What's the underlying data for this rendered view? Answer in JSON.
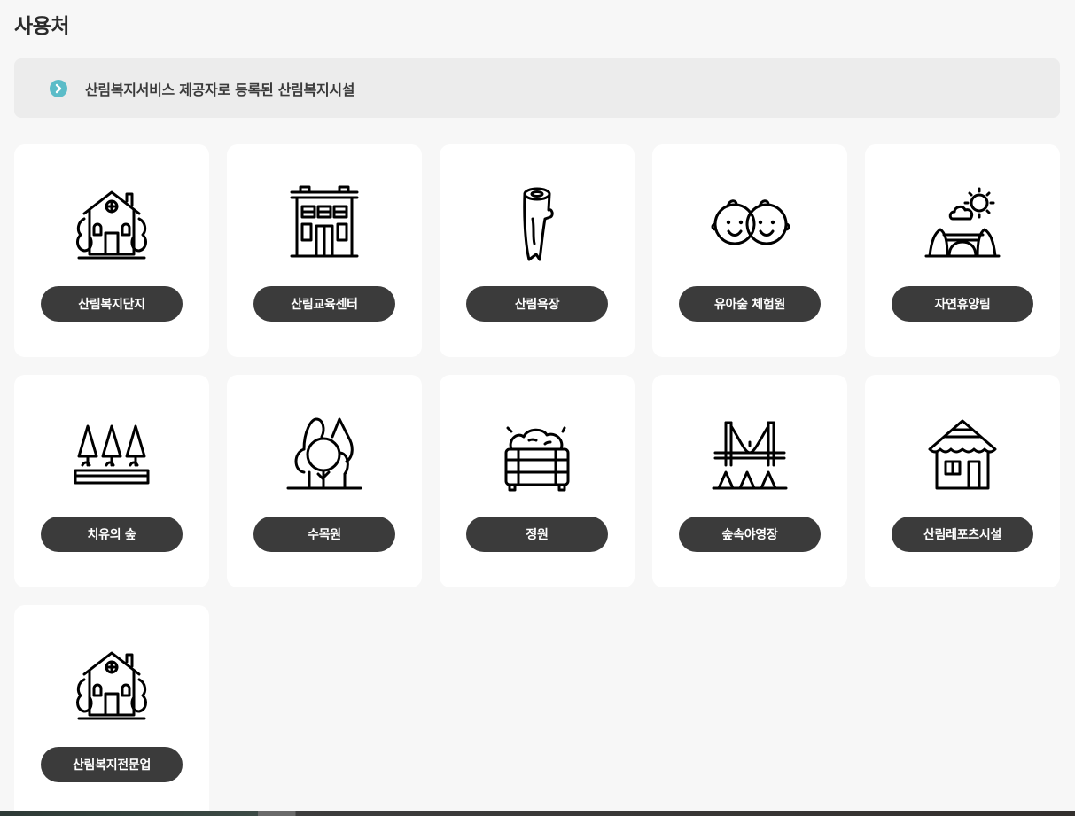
{
  "page": {
    "title": "사용처"
  },
  "notice": {
    "text": "산림복지서비스 제공자로 등록된 산림복지시설"
  },
  "facilities": [
    {
      "label": "산림복지단지",
      "icon": "house-tree-icon"
    },
    {
      "label": "산림교육센터",
      "icon": "building-icon"
    },
    {
      "label": "산림욕장",
      "icon": "log-icon"
    },
    {
      "label": "유아숲 체험원",
      "icon": "kids-faces-icon"
    },
    {
      "label": "자연휴양림",
      "icon": "sun-cloud-landscape-icon"
    },
    {
      "label": "치유의 숲",
      "icon": "pine-trees-icon"
    },
    {
      "label": "수목원",
      "icon": "forest-icon"
    },
    {
      "label": "정원",
      "icon": "planter-box-icon"
    },
    {
      "label": "숲속야영장",
      "icon": "bridge-tent-icon"
    },
    {
      "label": "산림레포츠시설",
      "icon": "hut-icon"
    },
    {
      "label": "산림복지전문업",
      "icon": "house-tree-icon"
    }
  ],
  "colors": {
    "accent": "#5bbcc8",
    "label_bg": "#3b3b3b",
    "page_bg": "#f7f7f7"
  }
}
